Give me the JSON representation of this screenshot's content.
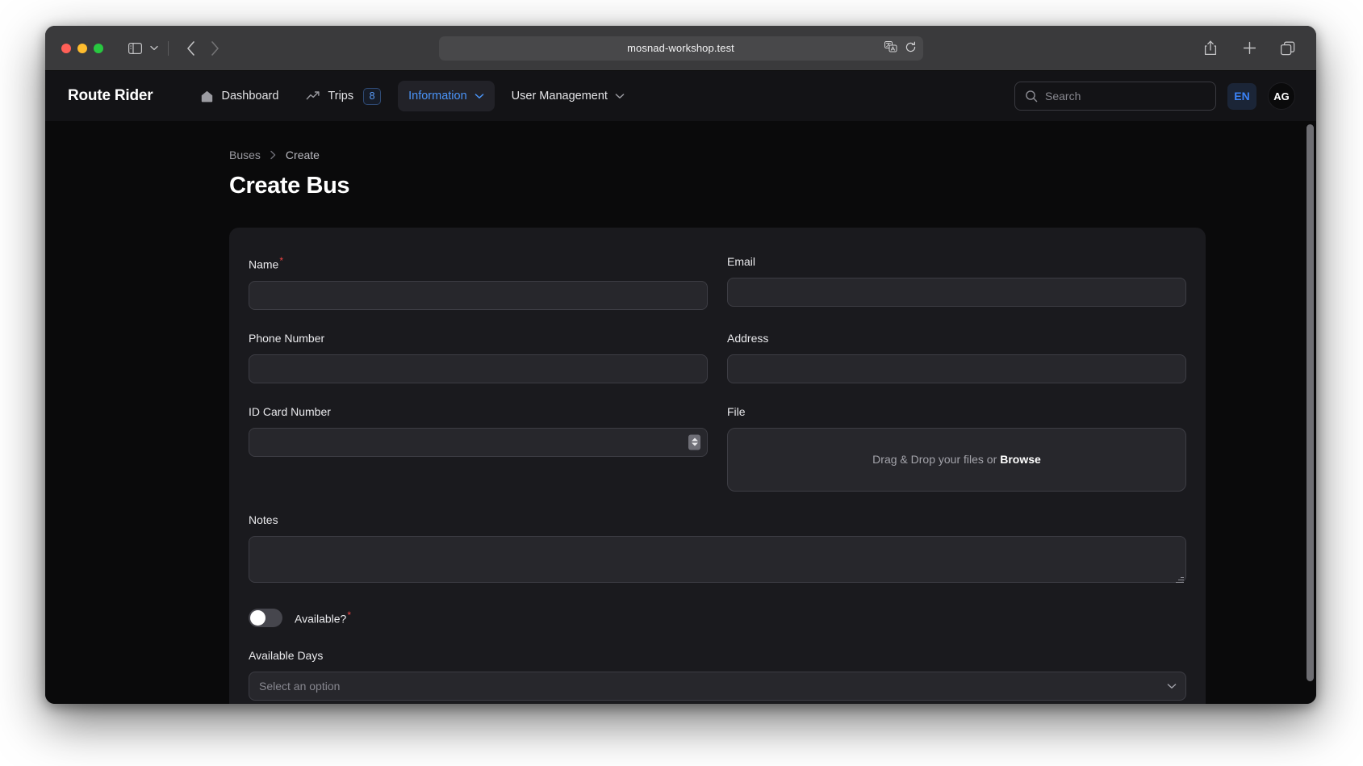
{
  "browser": {
    "url": "mosnad-workshop.test",
    "traffic_lights": [
      "close",
      "minimize",
      "maximize"
    ],
    "icons": {
      "sidebar": "sidebar-icon",
      "sidebar_chevron": "chevron-down-icon",
      "back": "chevron-left-icon",
      "forward": "chevron-right-icon",
      "translate": "translate-icon",
      "reload": "reload-icon",
      "share": "share-icon",
      "new_tab": "plus-icon",
      "tab_overview": "tab-overview-icon"
    }
  },
  "app": {
    "brand": "Route Rider",
    "nav_items": [
      {
        "label": "Dashboard",
        "icon": "home-icon",
        "active": false,
        "badge": null,
        "has_chevron": false
      },
      {
        "label": "Trips",
        "icon": "trending-up-icon",
        "active": false,
        "badge": "8",
        "has_chevron": false
      },
      {
        "label": "Information",
        "icon": null,
        "active": true,
        "badge": null,
        "has_chevron": true
      },
      {
        "label": "User Management",
        "icon": null,
        "active": false,
        "badge": null,
        "has_chevron": true
      }
    ],
    "search": {
      "placeholder": "Search",
      "value": "",
      "icon": "search-icon"
    },
    "language_badge": "EN",
    "avatar_initials": "AG",
    "colors": {
      "accent": "#3b82f6",
      "nav_active_text": "#4a94f8",
      "required_asterisk": "#ef4444",
      "card_bg": "#1a1a1e",
      "page_bg": "#0a0a0b",
      "nav_bg": "#131316",
      "input_bg": "#27272c"
    }
  },
  "page": {
    "breadcrumb": [
      {
        "label": "Buses",
        "current": false
      },
      {
        "label": "Create",
        "current": true
      }
    ],
    "breadcrumb_separator": "chevron-right-icon",
    "title": "Create Bus"
  },
  "form": {
    "fields": {
      "name": {
        "label": "Name",
        "required": true,
        "value": "",
        "placeholder": ""
      },
      "email": {
        "label": "Email",
        "required": false,
        "value": "",
        "placeholder": ""
      },
      "phone": {
        "label": "Phone Number",
        "required": false,
        "value": "",
        "placeholder": ""
      },
      "address": {
        "label": "Address",
        "required": false,
        "value": "",
        "placeholder": ""
      },
      "id_card": {
        "label": "ID Card Number",
        "required": false,
        "value": "",
        "placeholder": "",
        "type": "number"
      },
      "file": {
        "label": "File",
        "dropzone_text": "Drag & Drop your files or",
        "browse_label": "Browse"
      },
      "notes": {
        "label": "Notes",
        "required": false,
        "value": "",
        "placeholder": ""
      },
      "available": {
        "label": "Available?",
        "required": true,
        "checked": false
      },
      "available_days": {
        "label": "Available Days",
        "required": false,
        "selected_text": "Select an option",
        "chevron": "chevron-down-icon"
      }
    }
  }
}
